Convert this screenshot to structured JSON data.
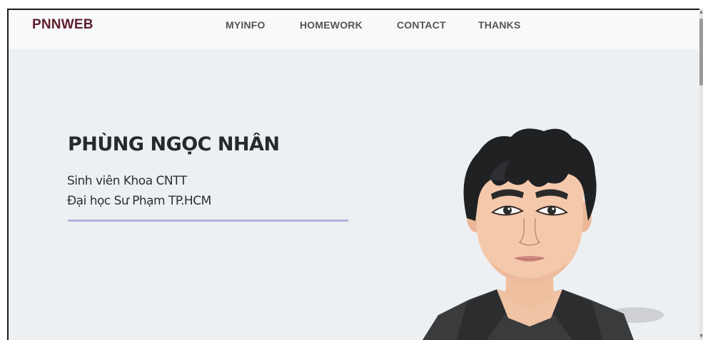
{
  "navbar": {
    "brand": "PNNWEB",
    "links": [
      "MYINFO",
      "HOMEWORK",
      "CONTACT",
      "THANKS"
    ]
  },
  "hero": {
    "name": "PHÙNG NGỌC NHÂN",
    "line1": "Sinh viên Khoa CNTT",
    "line2": "Đại học Sư Phạm TP.HCM"
  },
  "colors": {
    "page_background": "#edf0f3",
    "navbar_background": "#f8f9fa",
    "brand": "#5d1f2c",
    "nav_link": "#545454",
    "divider": "#b3b0d8"
  },
  "icons": {
    "scroll_up": "triangle-up",
    "scroll_down": "triangle-down"
  },
  "scroll": {
    "position_fraction": 0.0
  }
}
